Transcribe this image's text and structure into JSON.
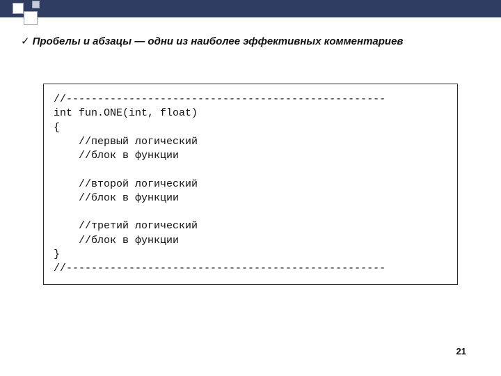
{
  "heading": {
    "checkmark": "✓",
    "text": "Пробелы и абзацы — одни из наиболее эффективных комментариев"
  },
  "code": {
    "line1": "//---------------------------------------------------",
    "line2": "int fun.ONE(int, float)",
    "line3": "{",
    "line4": "    //первый логический",
    "line5": "    //блок в функции",
    "line6": "",
    "line7": "    //второй логический",
    "line8": "    //блок в функции",
    "line9": "",
    "line10": "    //третий логический",
    "line11": "    //блок в функции",
    "line12": "}",
    "line13": "//---------------------------------------------------"
  },
  "page_number": "21"
}
